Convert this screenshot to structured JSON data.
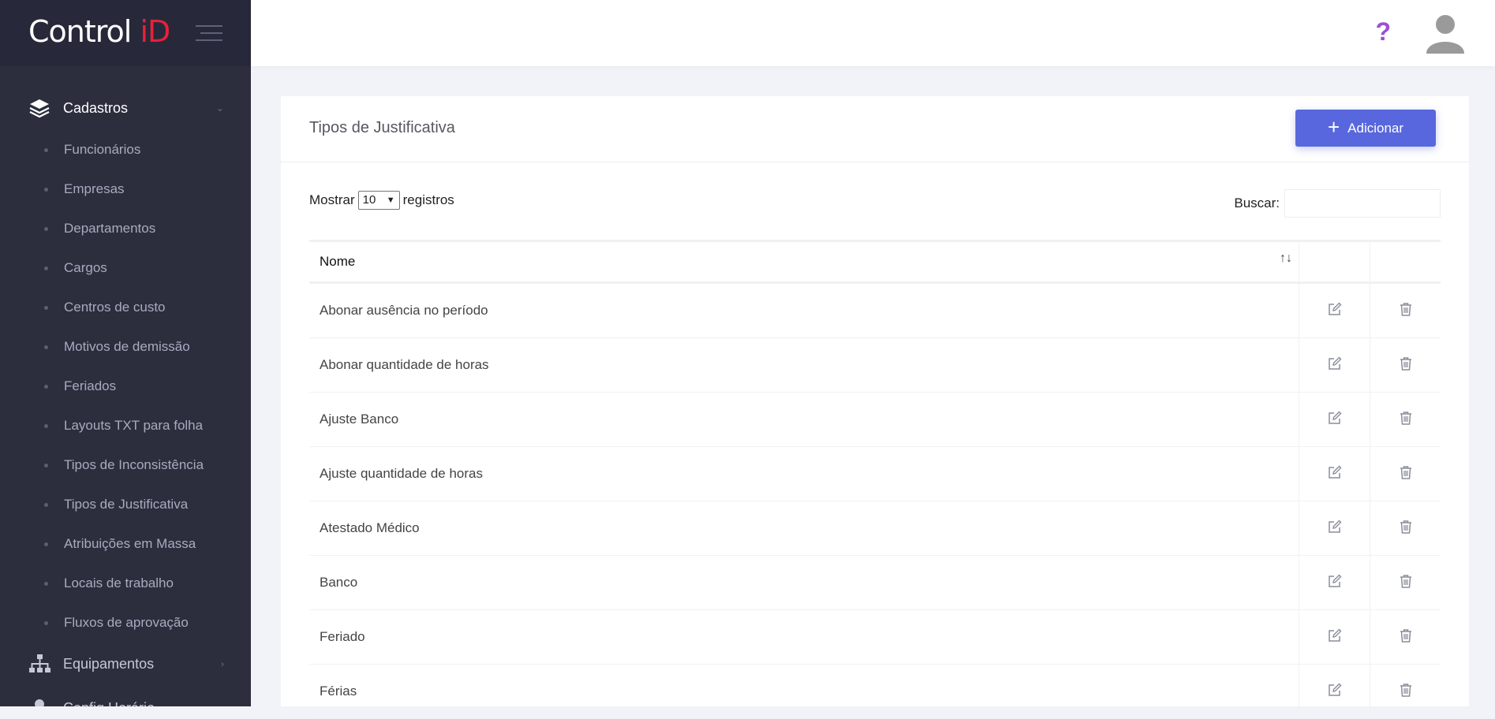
{
  "brand": {
    "logo_main": "Control ",
    "logo_accent": "iD"
  },
  "sidebar": {
    "cadastros": "Cadastros",
    "items": [
      {
        "label": "Funcionários"
      },
      {
        "label": "Empresas"
      },
      {
        "label": "Departamentos"
      },
      {
        "label": "Cargos"
      },
      {
        "label": "Centros de custo"
      },
      {
        "label": "Motivos de demissão"
      },
      {
        "label": "Feriados"
      },
      {
        "label": "Layouts TXT para folha"
      },
      {
        "label": "Tipos de Inconsistência"
      },
      {
        "label": "Tipos de Justificativa"
      },
      {
        "label": "Atribuições em Massa"
      },
      {
        "label": "Locais de trabalho"
      },
      {
        "label": "Fluxos de aprovação"
      }
    ],
    "equipamentos": "Equipamentos",
    "config_horario": "Config Horário"
  },
  "topbar": {
    "help": "?"
  },
  "page": {
    "title": "Tipos de Justificativa",
    "add_label": "Adicionar",
    "show_label": "Mostrar",
    "page_size": "10",
    "records_label": "registros",
    "search_label": "Buscar:",
    "search_value": ""
  },
  "table": {
    "column_name": "Nome",
    "rows": [
      {
        "name": "Abonar ausência no período"
      },
      {
        "name": "Abonar quantidade de horas"
      },
      {
        "name": "Ajuste Banco"
      },
      {
        "name": "Ajuste quantidade de horas"
      },
      {
        "name": "Atestado Médico"
      },
      {
        "name": "Banco"
      },
      {
        "name": "Feriado"
      },
      {
        "name": "Férias"
      }
    ]
  },
  "colors": {
    "sidebar_bg": "#2c2e3e",
    "accent": "#5867dd",
    "logo_red": "#e8203a",
    "help_purple": "#9b4fd6"
  }
}
